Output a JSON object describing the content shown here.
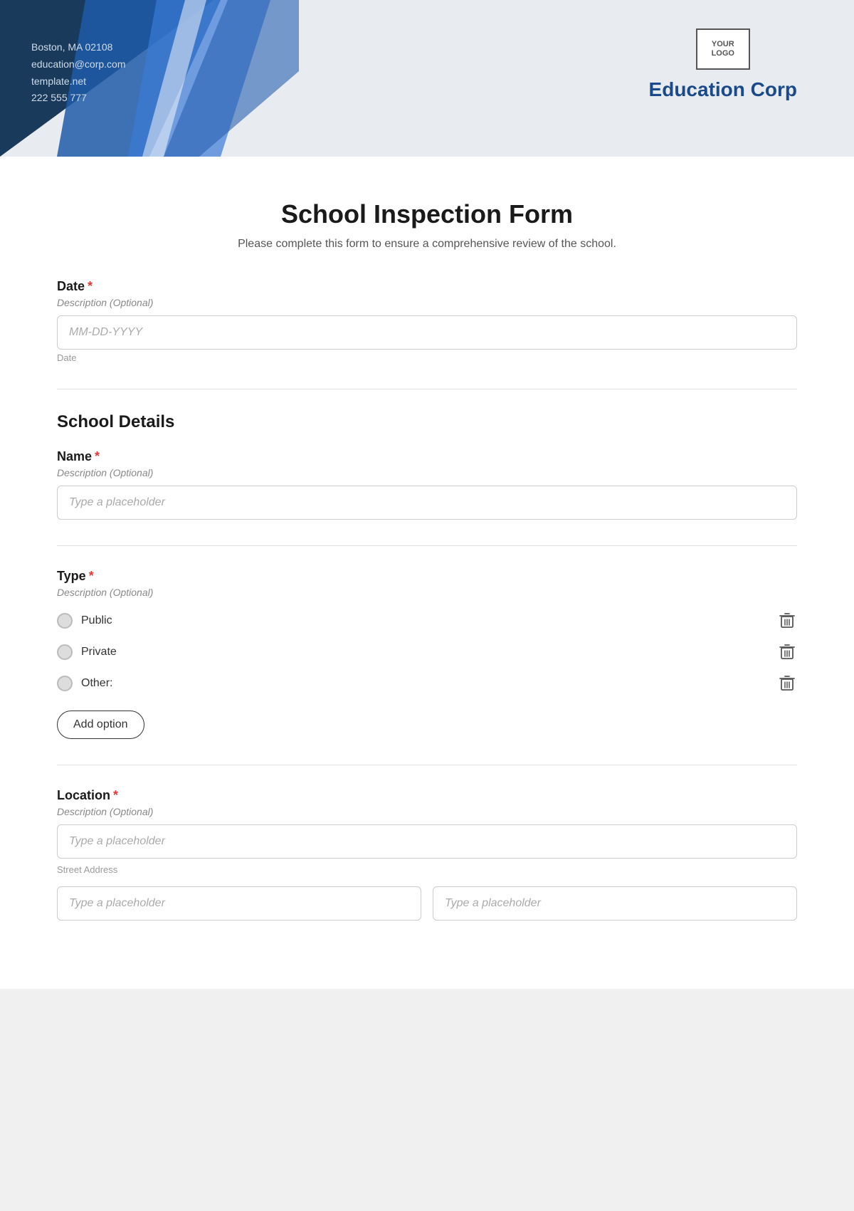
{
  "header": {
    "contact": {
      "address": "Boston, MA 02108",
      "email": "education@corp.com",
      "website": "template.net",
      "phone": "222 555 777"
    },
    "logo_text": "YOUR\nLOGO",
    "company_name": "Education Corp"
  },
  "form": {
    "title": "School Inspection Form",
    "subtitle": "Please complete this form to ensure a comprehensive review of the school.",
    "fields": {
      "date": {
        "label": "Date",
        "required": true,
        "description": "Description (Optional)",
        "placeholder": "MM-DD-YYYY",
        "hint": "Date"
      },
      "school_details": {
        "section_title": "School Details",
        "name": {
          "label": "Name",
          "required": true,
          "description": "Description (Optional)",
          "placeholder": "Type a placeholder"
        },
        "type": {
          "label": "Type",
          "required": true,
          "description": "Description (Optional)",
          "options": [
            {
              "label": "Public"
            },
            {
              "label": "Private"
            },
            {
              "label": "Other:"
            }
          ],
          "add_option_label": "Add option"
        },
        "location": {
          "label": "Location",
          "required": true,
          "description": "Description (Optional)",
          "street_placeholder": "Type a placeholder",
          "street_hint": "Street Address",
          "city_placeholder": "Type a placeholder",
          "state_placeholder": "Type a placeholder"
        }
      }
    }
  }
}
